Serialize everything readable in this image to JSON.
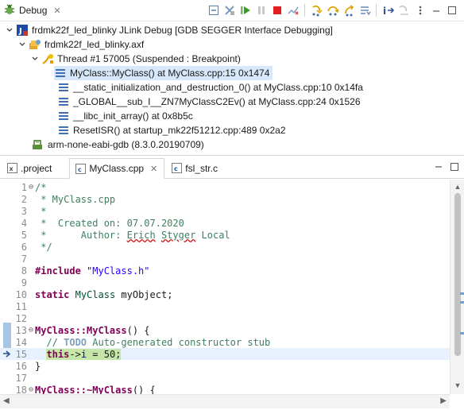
{
  "debug_view": {
    "tab_title": "Debug",
    "tab_close": "✕",
    "toolbar_icons": [
      "collapse-all-icon",
      "remove-terminated-icon",
      "resume-icon",
      "suspend-icon",
      "terminate-icon",
      "disconnect-icon",
      "step-into-icon",
      "step-over-icon",
      "step-return-icon",
      "drop-to-frame-icon",
      "instruction-stepping-icon",
      "use-step-filters-icon",
      "view-menu-icon",
      "minimize-icon",
      "maximize-icon"
    ],
    "tree": [
      {
        "label": "frdmk22f_led_blinky JLink Debug [GDB SEGGER Interface Debugging]",
        "icon": "launch-config-icon",
        "expanded": true
      },
      {
        "label": "frdmk22f_led_blinky.axf",
        "icon": "process-icon",
        "expanded": true
      },
      {
        "label": "Thread #1 57005 (Suspended : Breakpoint)",
        "icon": "thread-icon",
        "expanded": true
      },
      {
        "label": "MyClass::MyClass() at MyClass.cpp:15 0x1474",
        "icon": "stack-frame-icon",
        "selected": true
      },
      {
        "label": "__static_initialization_and_destruction_0() at MyClass.cpp:10 0x14fa",
        "icon": "stack-frame-icon"
      },
      {
        "label": "_GLOBAL__sub_I__ZN7MyClassC2Ev() at MyClass.cpp:24 0x1526",
        "icon": "stack-frame-icon"
      },
      {
        "label": "__libc_init_array() at 0x8b5c",
        "icon": "stack-frame-icon"
      },
      {
        "label": "ResetISR() at startup_mk22f51212.cpp:489 0x2a2",
        "icon": "stack-frame-icon"
      },
      {
        "label": "arm-none-eabi-gdb (8.3.0.20190709)",
        "icon": "gdb-process-icon"
      }
    ]
  },
  "editor": {
    "tabs": [
      {
        "label": ".project",
        "icon": "xml-file-icon",
        "active": false
      },
      {
        "label": "MyClass.cpp",
        "icon": "cpp-file-icon",
        "active": true,
        "close": "✕"
      },
      {
        "label": "fsl_str.c",
        "icon": "c-file-icon",
        "active": false
      }
    ],
    "lines": [
      {
        "n": "1",
        "fold": "⊖",
        "parts": [
          {
            "t": "/*",
            "c": "c-com"
          }
        ]
      },
      {
        "n": "2",
        "parts": [
          {
            "t": " * MyClass.cpp",
            "c": "c-com"
          }
        ]
      },
      {
        "n": "3",
        "parts": [
          {
            "t": " *",
            "c": "c-com"
          }
        ]
      },
      {
        "n": "4",
        "parts": [
          {
            "t": " *  Created on: 07.07.2020",
            "c": "c-com"
          }
        ]
      },
      {
        "n": "5",
        "parts": [
          {
            "t": " *      Author: ",
            "c": "c-com"
          },
          {
            "t": "Erich",
            "c": "c-com sq"
          },
          {
            "t": " ",
            "c": "c-com"
          },
          {
            "t": "Styger",
            "c": "c-com sq"
          },
          {
            "t": " Local",
            "c": "c-com"
          }
        ]
      },
      {
        "n": "6",
        "parts": [
          {
            "t": " */",
            "c": "c-com"
          }
        ]
      },
      {
        "n": "7",
        "parts": []
      },
      {
        "n": "8",
        "parts": [
          {
            "t": "#include",
            "c": "c-pp"
          },
          {
            "t": " ",
            "c": ""
          },
          {
            "t": "\"MyClass.h\"",
            "c": "c-str"
          }
        ]
      },
      {
        "n": "9",
        "parts": []
      },
      {
        "n": "10",
        "parts": [
          {
            "t": "static",
            "c": "c-kw"
          },
          {
            "t": " ",
            "c": ""
          },
          {
            "t": "MyClass",
            "c": "c-cls"
          },
          {
            "t": " myObject;",
            "c": ""
          }
        ]
      },
      {
        "n": "11",
        "parts": []
      },
      {
        "n": "12",
        "parts": []
      },
      {
        "n": "13",
        "fold": "⊖",
        "parts": [
          {
            "t": "MyClass::MyClass",
            "c": "c-kw"
          },
          {
            "t": "() {",
            "c": ""
          }
        ]
      },
      {
        "n": "14",
        "parts": [
          {
            "t": "  // ",
            "c": "c-com"
          },
          {
            "t": "TODO",
            "c": "c-todo"
          },
          {
            "t": " Auto-generated constructor stub",
            "c": "c-com"
          }
        ]
      },
      {
        "n": "15",
        "exec": true,
        "parts": [
          {
            "t": "  ",
            "c": ""
          },
          {
            "t": "this",
            "c": "c-kw hl"
          },
          {
            "t": "->",
            "c": "hl"
          },
          {
            "t": "i",
            "c": "c-var hl"
          },
          {
            "t": " = 50;",
            "c": "hl"
          }
        ]
      },
      {
        "n": "16",
        "parts": [
          {
            "t": "}",
            "c": ""
          }
        ]
      },
      {
        "n": "17",
        "parts": []
      },
      {
        "n": "18",
        "fold": "⊖",
        "parts": [
          {
            "t": "MyClass::~MyClass",
            "c": "c-kw"
          },
          {
            "t": "() {",
            "c": ""
          }
        ]
      }
    ]
  }
}
